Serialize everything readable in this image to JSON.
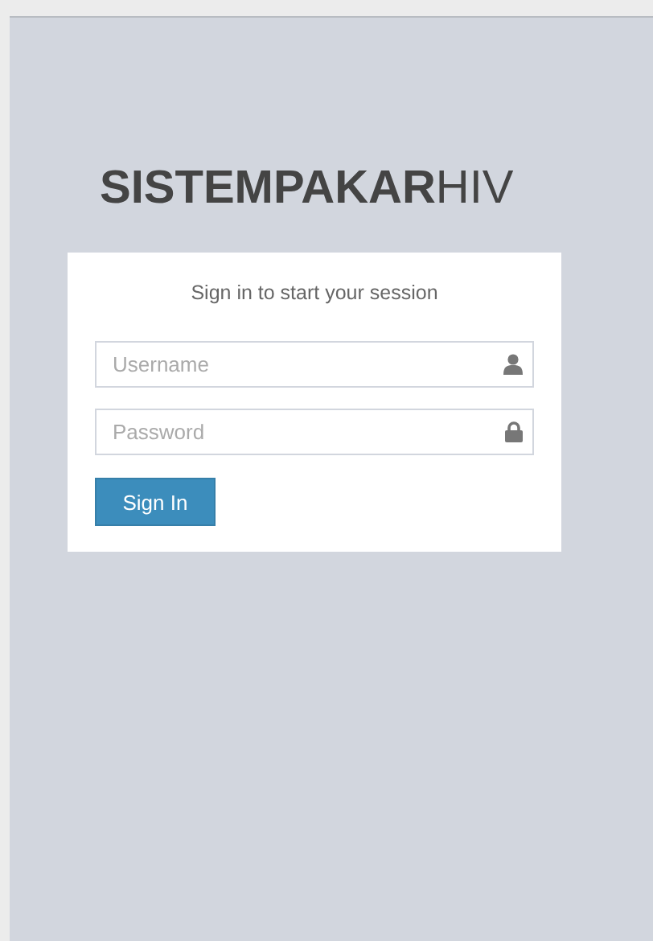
{
  "logo": "**SISTEMPAKAR**HIV",
  "login_box": {
    "message": "Sign in to start your session",
    "fields": [
      {
        "kind": "text",
        "placeholder": "Username"
      },
      {
        "kind": "password",
        "placeholder": "Password"
      }
    ],
    "button": "Sign In"
  }
}
